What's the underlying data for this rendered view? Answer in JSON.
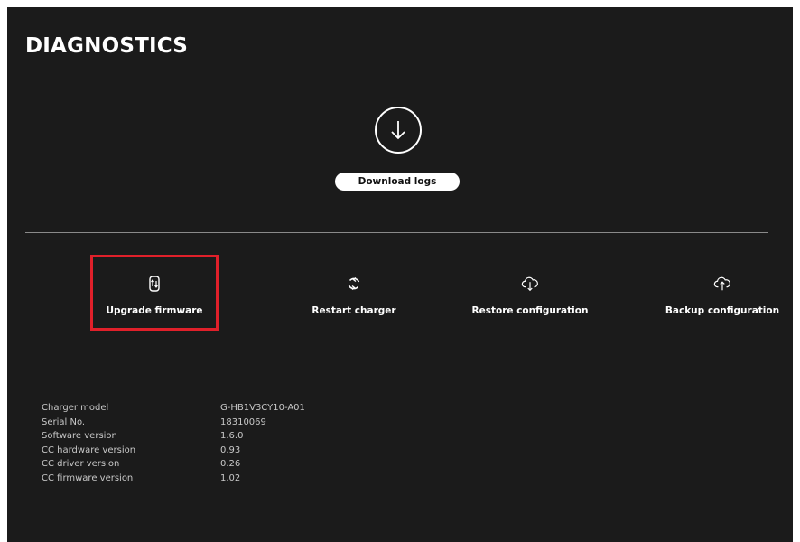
{
  "page": {
    "title": "DIAGNOSTICS"
  },
  "download": {
    "icon": "arrow-down-circle-icon",
    "button_label": "Download logs"
  },
  "actions": [
    {
      "label": "Upgrade firmware",
      "icon": "firmware-upgrade-icon",
      "highlighted": true
    },
    {
      "label": "Restart charger",
      "icon": "restart-icon",
      "highlighted": false
    },
    {
      "label": "Restore configuration",
      "icon": "cloud-download-icon",
      "highlighted": false
    },
    {
      "label": "Backup configuration",
      "icon": "cloud-upload-icon",
      "highlighted": false
    }
  ],
  "info": [
    {
      "key": "Charger model",
      "value": "G-HB1V3CY10-A01"
    },
    {
      "key": "Serial No.",
      "value": "18310069"
    },
    {
      "key": "Software version",
      "value": "1.6.0"
    },
    {
      "key": "CC hardware version",
      "value": "0.93"
    },
    {
      "key": "CC driver version",
      "value": "0.26"
    },
    {
      "key": "CC firmware version",
      "value": "1.02"
    }
  ],
  "colors": {
    "panel_background": "#1b1b1b",
    "text": "#ffffff",
    "highlight_border": "#e0202a",
    "divider": "#8a8a8a"
  }
}
